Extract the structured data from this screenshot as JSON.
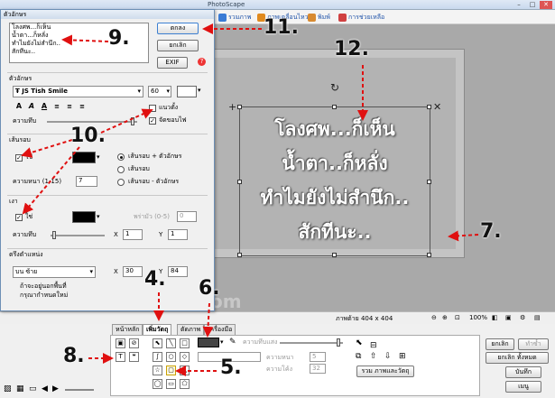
{
  "app": {
    "title": "PhotoScape"
  },
  "menubar": {
    "items": [
      {
        "label": "รวมภาพ",
        "color": "#3a7bd5"
      },
      {
        "label": "ภาพเคลื่อนไหว",
        "color": "#e08a1e"
      },
      {
        "label": "พิมพ์",
        "color": "#666666"
      },
      {
        "label": "การช่วยเหลือ",
        "color": "#d04040"
      }
    ]
  },
  "dialog": {
    "title": "ตัวอักษร",
    "text_value": [
      "โลงศพ...ก็เห็น",
      "น้ำตา...ก็หลั่ง",
      "ทำไมยังไม่สำนึก..",
      "สักทีนะ.."
    ],
    "ok_label": "ตกลง",
    "cancel_label": "ยกเลิก",
    "exif_label": "EXIF",
    "font_section": "ตัวอักษร",
    "font_name": "JS Tish Smile",
    "font_size": "60",
    "opacity_label": "ความทึบ",
    "vertical_label": "แนวตั้ง",
    "antialias_label": "จัดขอบไฟ",
    "outline_section": "เส้นรอบ",
    "outline_use_label": "ใช่",
    "outline_width_label": "ความหนา (1-15)",
    "outline_width_value": "7",
    "outline_opt1": "เส้นรอบ + ตัวอักษร",
    "outline_opt2": "เส้นรอบ",
    "outline_opt3": "เส้นรอบ - ตัวอักษร",
    "shadow_section": "เงา",
    "shadow_use_label": "ใช่",
    "shadow_blur_label": "พร่ามัว (0-5)",
    "shadow_blur_value": "0",
    "shadow_opacity_label": "ความทึบ",
    "shadow_x_label": "X",
    "shadow_x_value": "1",
    "shadow_y_label": "Y",
    "shadow_y_value": "1",
    "position_section": "ตรึงตำแหน่ง",
    "position_value": "บน ซ้าย",
    "position_x_label": "X",
    "position_x_value": "30",
    "position_y_label": "Y",
    "position_y_value": "84",
    "position_note_1": "ถ้าจะอยู่นอกพื้นที่",
    "position_note_2": "กรุณากำหนดใหม่"
  },
  "canvas": {
    "text_lines": [
      "โลงศพ...ก็เห็น",
      "น้ำตา..ก็หลั่ง",
      "ทำไมยังไม่สำนึก..",
      "สักทีนะ.."
    ],
    "watermark": "SiamsBook.com"
  },
  "statusbar": {
    "size": "ภาพต้าย 404 x 404",
    "zoom": "100%"
  },
  "lower_panel": {
    "tabs": [
      "หน้าหลัก",
      "เพิ่มวัตถุ",
      "ตัดภาพ",
      "เครื่องมือ"
    ],
    "opacity_label": "ความทึบแสง",
    "thickness_label": "ความหนา",
    "thickness_value": "5",
    "roundness_label": "ความโค้ง",
    "roundness_value": "32",
    "merge_label": "รวม ภาพและวัตถุ",
    "undo_label": "ยกเลิก",
    "redo_label": "ทำซ้ำ",
    "undo_all_label": "ยกเลิก ทั้งหมด",
    "save_label": "บันทึก",
    "menu_label": "เมนู"
  },
  "annotations": {
    "n4": "4.",
    "n5": "5.",
    "n6": "6.",
    "n7": "7.",
    "n8": "8.",
    "n9": "9.",
    "n10": "10.",
    "n11": "11.",
    "n12": "12."
  },
  "colors": {
    "arrow": "#e01010",
    "outline_swatch": "#000000",
    "shadow_swatch": "#000000",
    "text_color": "#ffffff"
  }
}
